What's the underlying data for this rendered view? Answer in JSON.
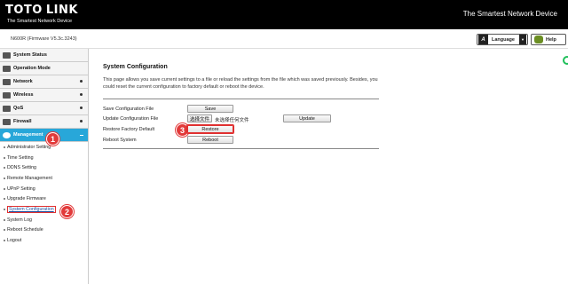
{
  "header": {
    "brand_a": "TOTO",
    "brand_b": "LINK",
    "tagline": "The Smartest Network Device",
    "slogan": "The Smartest Network Device",
    "model": "N600R (Firmware V5.3c.3243)",
    "language_label": "Language",
    "help_label": "Help"
  },
  "sidebar": {
    "items": [
      {
        "label": "System Status"
      },
      {
        "label": "Operation Mode"
      },
      {
        "label": "Network"
      },
      {
        "label": "Wireless"
      },
      {
        "label": "QoS"
      },
      {
        "label": "Firewall"
      },
      {
        "label": "Management"
      }
    ],
    "subitems": [
      {
        "label": "Administrator Setting"
      },
      {
        "label": "Time Setting"
      },
      {
        "label": "DDNS Setting"
      },
      {
        "label": "Remote Management"
      },
      {
        "label": "UPnP Setting"
      },
      {
        "label": "Upgrade Firmware"
      },
      {
        "label": "System Configuration"
      },
      {
        "label": "System Log"
      },
      {
        "label": "Reboot Schedule"
      },
      {
        "label": "Logout"
      }
    ]
  },
  "callouts": [
    "1",
    "2",
    "3"
  ],
  "main": {
    "title": "System Configuration",
    "description": "This page allows you save current settings to a file or reload the settings from the file which was saved previously. Besides, you could reset the current configuration to factory default or reboot the device.",
    "rows": {
      "save_label": "Save Configuration File",
      "save_button": "Save",
      "update_label": "Update Configuration File",
      "choose_file_button": "选择文件",
      "no_file_text": "未选择任何文件",
      "update_button": "Update",
      "restore_label": "Restore Factory Default",
      "restore_button": "Restore",
      "reboot_label": "Reboot System",
      "reboot_button": "Reboot"
    }
  },
  "colors": {
    "header_bg": "#000000",
    "active_menu": "#28a7d9",
    "callout": "#e23a3a",
    "highlight_border": "#e03030"
  }
}
